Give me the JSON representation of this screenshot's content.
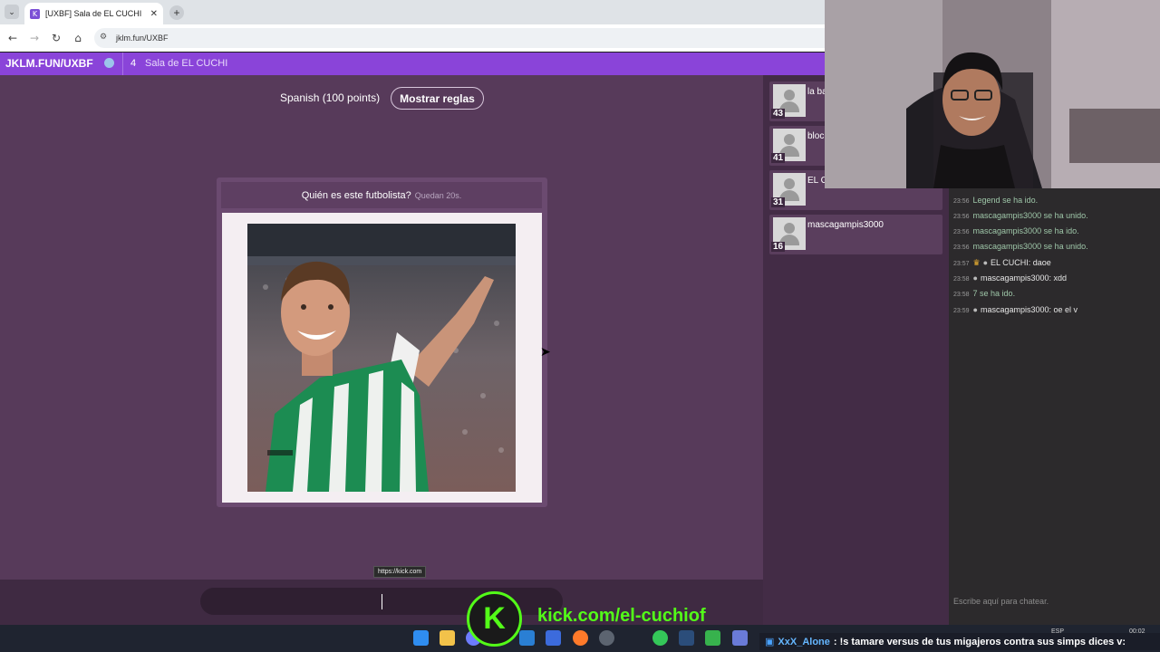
{
  "browser": {
    "tab_title": "[UXBF] Sala de EL CUCHI",
    "favicon": "K",
    "url": "jklm.fun/UXBF"
  },
  "room": {
    "code": "JKLM.FUN/UXBF",
    "player_count": "4",
    "name": "Sala de EL CUCHI"
  },
  "game": {
    "rules_label": "Spanish (100 points)",
    "rules_button": "Mostrar reglas",
    "question": "Quién es este futbolista?",
    "timer": "Quedan 20s."
  },
  "players": [
    {
      "name": "la ba",
      "score": "43"
    },
    {
      "name": "bloc",
      "score": "41"
    },
    {
      "name": "EL C",
      "score": "31"
    },
    {
      "name": "mascagampis3000",
      "score": "16"
    }
  ],
  "chat": {
    "messages": [
      {
        "time": "23:56",
        "text": "Legend se ha ido.",
        "kind": "sys"
      },
      {
        "time": "23:56",
        "text": "mascagampis3000 se ha unido.",
        "kind": "sys"
      },
      {
        "time": "23:56",
        "text": "mascagampis3000 se ha ido.",
        "kind": "sys"
      },
      {
        "time": "23:56",
        "text": "mascagampis3000 se ha unido.",
        "kind": "sys"
      },
      {
        "time": "23:57",
        "text": "EL CUCHI: daoe",
        "kind": "usr"
      },
      {
        "time": "23:58",
        "text": "mascagampis3000: xdd",
        "kind": "usr"
      },
      {
        "time": "23:58",
        "text": "7  se ha ido.",
        "kind": "sys"
      },
      {
        "time": "23:59",
        "text": "mascagampis3000: oe el v",
        "kind": "usr"
      }
    ],
    "placeholder": "Escribe aquí para chatear."
  },
  "overlay": {
    "tooltip": "https://kick.com",
    "kick_letter": "K",
    "kick_url": "kick.com/el-cuchiof",
    "ticker_user": "XxX_Alone",
    "ticker_msg": ": !s tamare versus de tus migajeros contra sus simps dices v:"
  },
  "tray": {
    "lang": "ESP",
    "clock": "00:02"
  },
  "colors": {
    "room_bar": "#8a44d9",
    "main_bg": "#573a5a",
    "kick_green": "#53fc18"
  }
}
